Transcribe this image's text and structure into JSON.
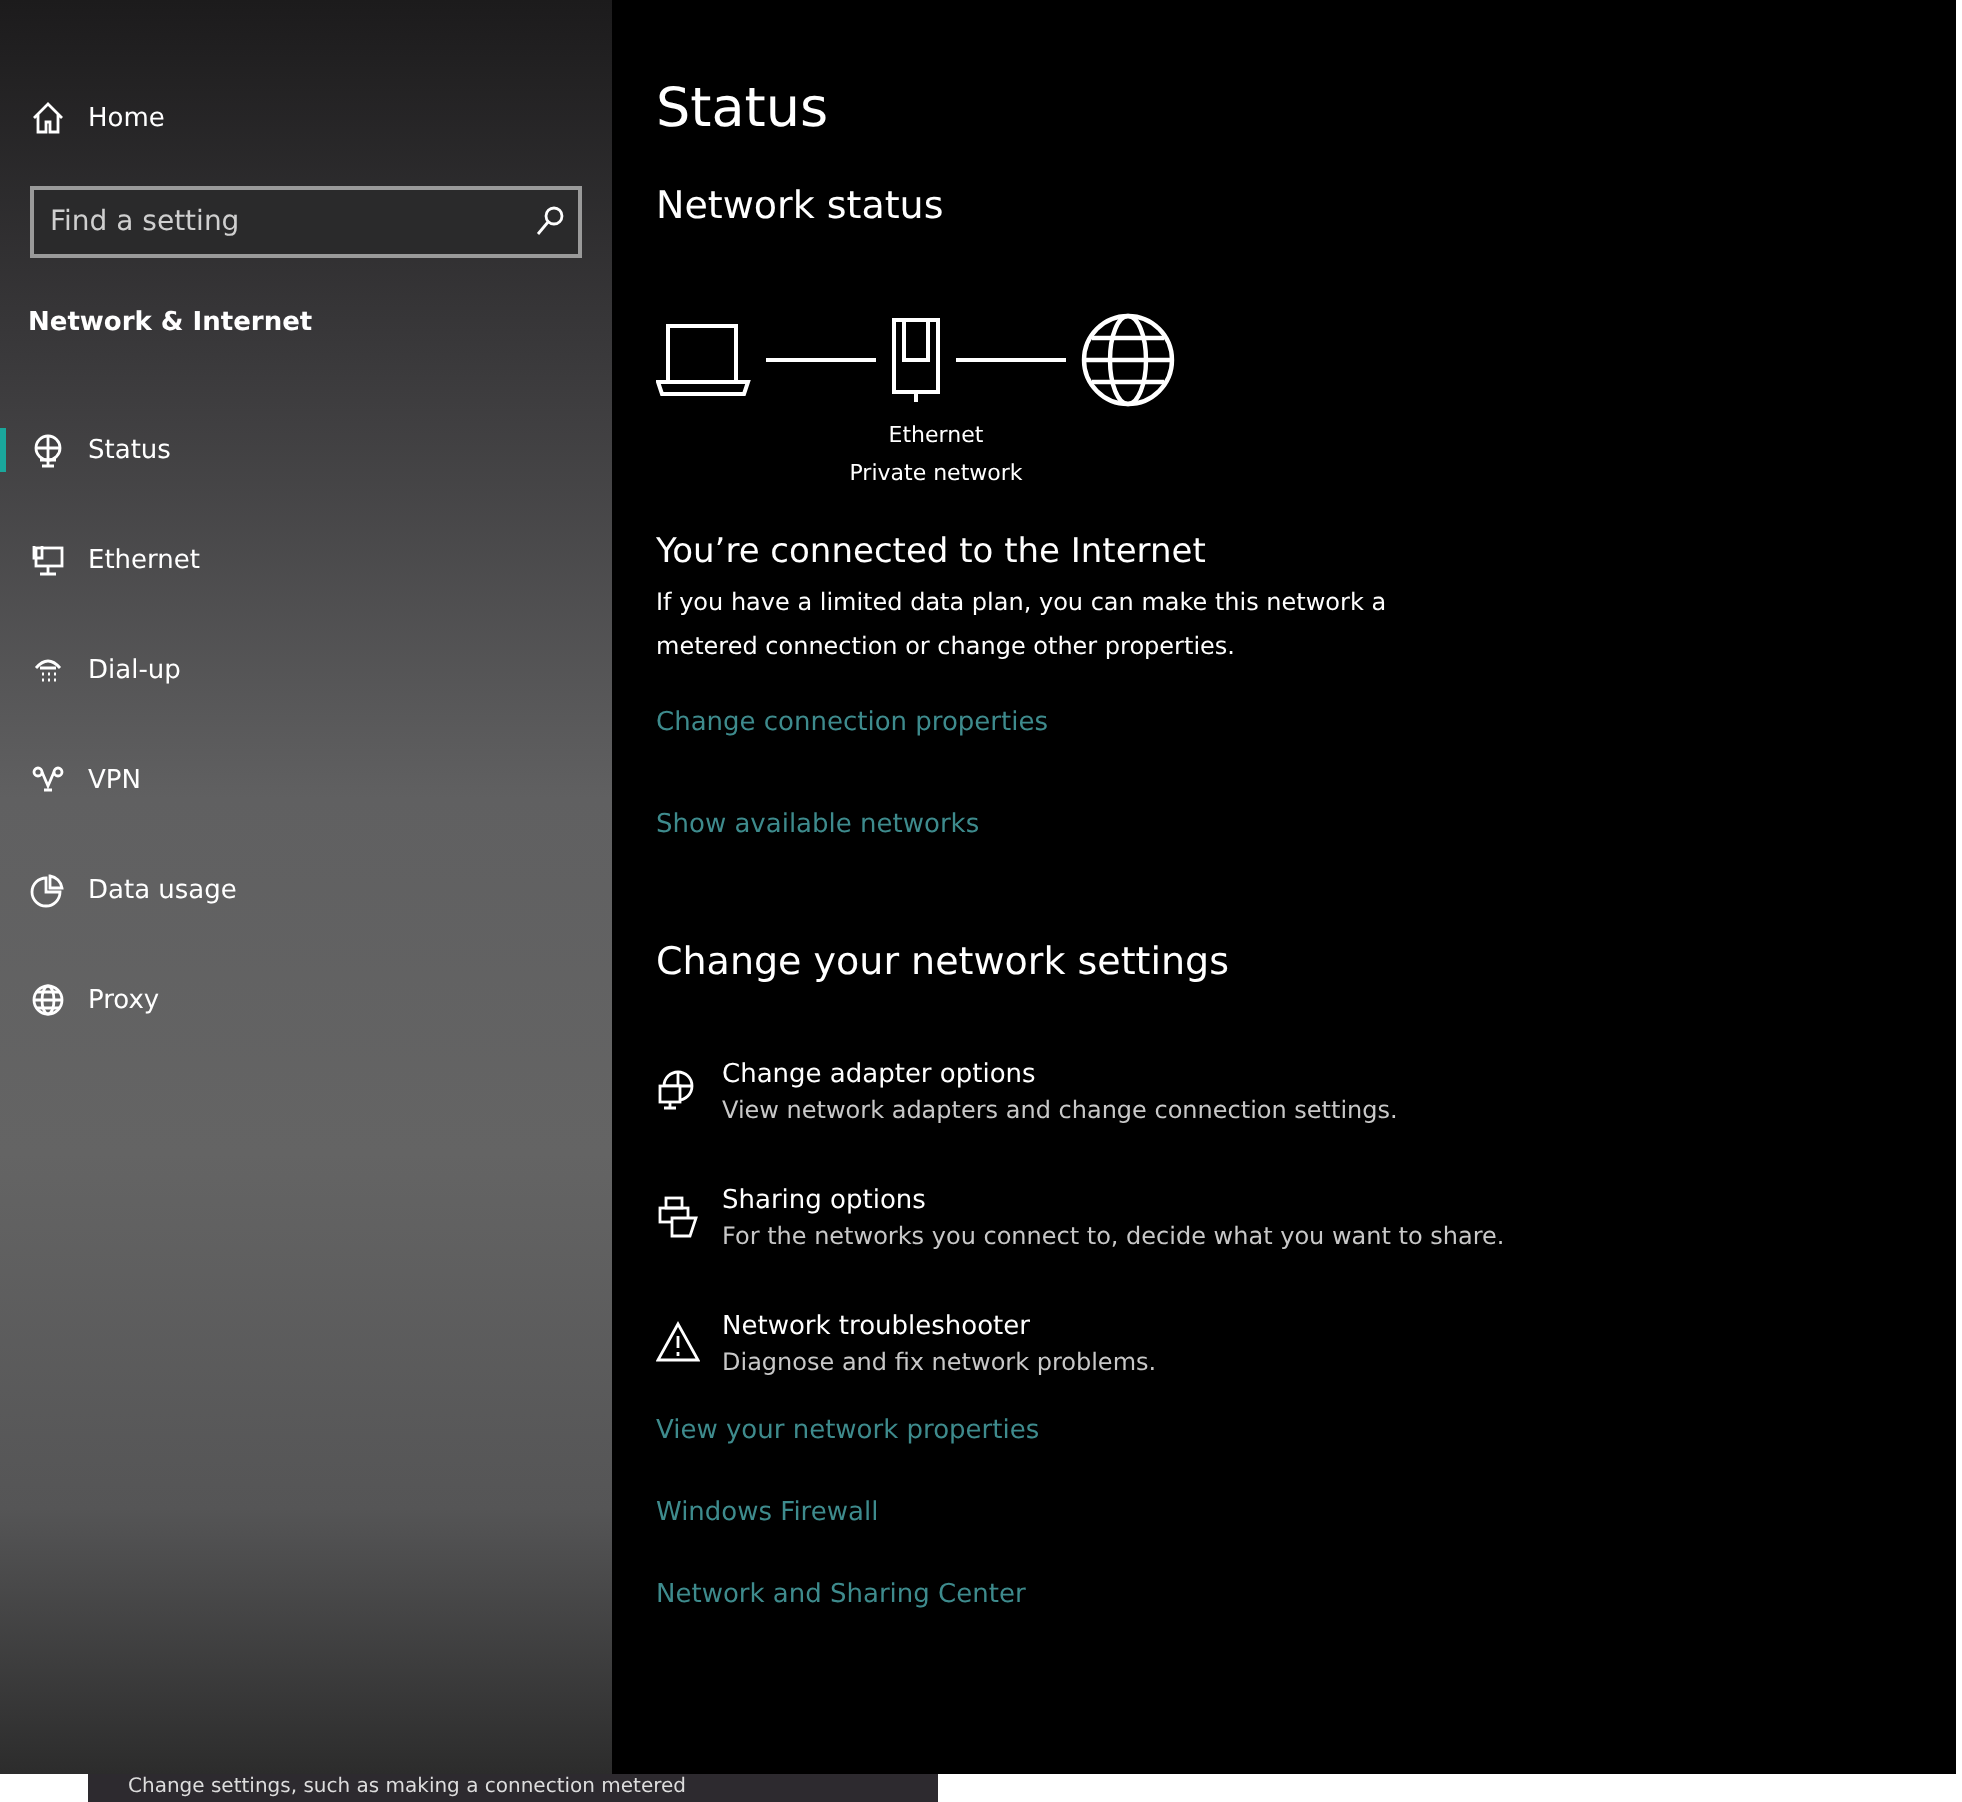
{
  "sidebar": {
    "home": {
      "label": "Home"
    },
    "search": {
      "placeholder": "Find a setting"
    },
    "section_title": "Network & Internet",
    "items": [
      {
        "label": "Status",
        "kind": "status",
        "selected": true
      },
      {
        "label": "Ethernet",
        "kind": "ethernet",
        "selected": false
      },
      {
        "label": "Dial-up",
        "kind": "dialup",
        "selected": false
      },
      {
        "label": "VPN",
        "kind": "vpn",
        "selected": false
      },
      {
        "label": "Data usage",
        "kind": "data",
        "selected": false
      },
      {
        "label": "Proxy",
        "kind": "proxy",
        "selected": false
      }
    ]
  },
  "main": {
    "title": "Status",
    "section_title": "Network status",
    "diagram": {
      "adapter_name": "Ethernet",
      "network_type": "Private network"
    },
    "connected_heading": "You’re connected to the Internet",
    "connected_text": "If you have a limited data plan, you can make this network a metered connection or change other properties.",
    "links": [
      "Change connection properties",
      "Show available networks"
    ],
    "change_heading": "Change your network settings",
    "options": [
      {
        "kind": "adapter",
        "title": "Change adapter options",
        "description": "View network adapters and change connection settings."
      },
      {
        "kind": "sharing",
        "title": "Sharing options",
        "description": "For the networks you connect to, decide what you want to share."
      },
      {
        "kind": "troubleshoot",
        "title": "Network troubleshooter",
        "description": "Diagnose and fix network problems."
      }
    ],
    "bottom_links": [
      "View your network properties",
      "Windows Firewall",
      "Network and Sharing Center"
    ]
  },
  "tooltip": "Change settings, such as making a connection metered"
}
